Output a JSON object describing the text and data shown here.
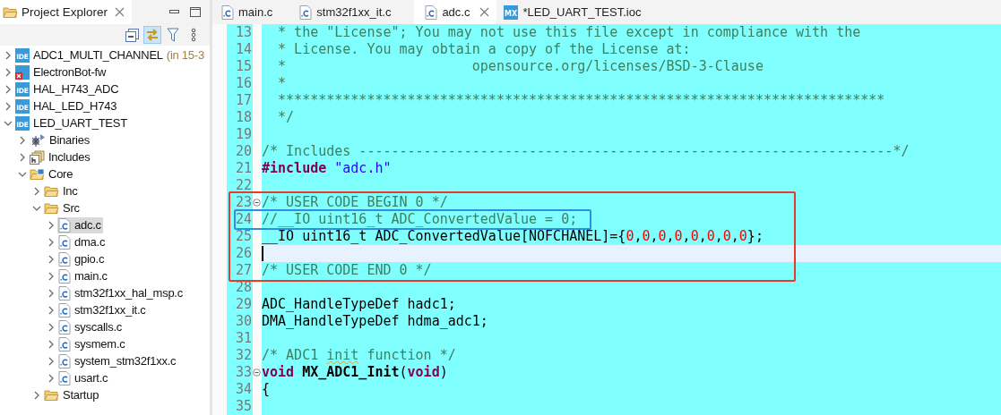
{
  "explorer": {
    "title": "Project Explorer",
    "toolbar": [
      {
        "kind": "collapse",
        "pressed": false
      },
      {
        "kind": "link",
        "pressed": true
      },
      {
        "kind": "filter",
        "pressed": false
      },
      {
        "kind": "more",
        "pressed": false
      }
    ],
    "tree": [
      {
        "kind": "project",
        "icon_label": "IDE",
        "label": "ADC1_MULTI_CHANNEL",
        "decoration": "(in 15-3",
        "error": false,
        "expanded": false,
        "selected": false
      },
      {
        "kind": "project",
        "label": "ElectronBot-fw",
        "error": true,
        "expanded": false,
        "selected": false
      },
      {
        "kind": "project",
        "icon_label": "IDE",
        "label": "HAL_H743_ADC",
        "error": false,
        "expanded": false,
        "selected": false
      },
      {
        "kind": "project",
        "icon_label": "IDE",
        "label": "HAL_LED_H743",
        "error": false,
        "expanded": false,
        "selected": false
      },
      {
        "kind": "project",
        "icon_label": "IDE",
        "label": "LED_UART_TEST",
        "error": false,
        "expanded": true,
        "selected": false,
        "children": [
          {
            "kind": "binaries",
            "label": "Binaries",
            "expanded": false,
            "selected": false
          },
          {
            "kind": "includes",
            "label": "Includes",
            "expanded": false,
            "selected": false
          },
          {
            "kind": "source_folder",
            "label": "Core",
            "expanded": true,
            "selected": false,
            "children": [
              {
                "kind": "folder",
                "label": "Inc",
                "expanded": false,
                "selected": false
              },
              {
                "kind": "folder",
                "label": "Src",
                "expanded": true,
                "selected": false,
                "children": [
                  {
                    "kind": "c_file",
                    "label": "adc.c",
                    "expanded": false,
                    "selected": true
                  },
                  {
                    "kind": "c_file",
                    "label": "dma.c",
                    "expanded": false,
                    "selected": false
                  },
                  {
                    "kind": "c_file",
                    "label": "gpio.c",
                    "expanded": false,
                    "selected": false
                  },
                  {
                    "kind": "c_file",
                    "label": "main.c",
                    "expanded": false,
                    "selected": false
                  },
                  {
                    "kind": "c_file",
                    "label": "stm32f1xx_hal_msp.c",
                    "expanded": false,
                    "selected": false
                  },
                  {
                    "kind": "c_file",
                    "label": "stm32f1xx_it.c",
                    "expanded": false,
                    "selected": false
                  },
                  {
                    "kind": "c_file",
                    "label": "syscalls.c",
                    "expanded": false,
                    "selected": false
                  },
                  {
                    "kind": "c_file",
                    "label": "sysmem.c",
                    "expanded": false,
                    "selected": false
                  },
                  {
                    "kind": "c_file",
                    "label": "system_stm32f1xx.c",
                    "expanded": false,
                    "selected": false
                  },
                  {
                    "kind": "c_file",
                    "label": "usart.c",
                    "expanded": false,
                    "selected": false
                  }
                ]
              },
              {
                "kind": "folder",
                "label": "Startup",
                "expanded": false,
                "selected": false
              }
            ]
          }
        ]
      }
    ]
  },
  "editor": {
    "tabs": [
      {
        "kind": "c_file",
        "label": "main.c",
        "selected": false
      },
      {
        "kind": "c_file",
        "label": "stm32f1xx_it.c",
        "selected": false
      },
      {
        "kind": "c_file",
        "label": "adc.c",
        "selected": true
      },
      {
        "kind": "mx",
        "icon_label": "MX",
        "label": "*LED_UART_TEST.ioc",
        "selected": false
      }
    ],
    "content": [
      {
        "kind": "line",
        "number": "13",
        "segments": [
          {
            "kind": "comment",
            "text": "  * the \"License\"; You may not use this file except in compliance with the"
          }
        ]
      },
      {
        "kind": "line",
        "number": "14",
        "segments": [
          {
            "kind": "comment",
            "text": "  * License. You may obtain a copy of the License at:"
          }
        ]
      },
      {
        "kind": "line",
        "number": "15",
        "segments": [
          {
            "kind": "comment",
            "text": "  *                       opensource.org/licenses/BSD-3-Clause"
          }
        ]
      },
      {
        "kind": "line",
        "number": "16",
        "segments": [
          {
            "kind": "comment",
            "text": "  *"
          }
        ]
      },
      {
        "kind": "line",
        "number": "17",
        "segments": [
          {
            "kind": "comment",
            "text": "  ***************************************************************************"
          }
        ]
      },
      {
        "kind": "line",
        "number": "18",
        "segments": [
          {
            "kind": "comment",
            "text": "  */"
          }
        ]
      },
      {
        "kind": "line",
        "number": "19"
      },
      {
        "kind": "line",
        "number": "20",
        "segments": [
          {
            "kind": "comment",
            "text": "/* Includes ------------------------------------------------------------------*/"
          }
        ]
      },
      {
        "kind": "line",
        "number": "21",
        "segments": [
          {
            "kind": "keyword",
            "text": "#include"
          },
          {
            "kind": "string",
            "text": " \"adc.h\""
          }
        ]
      },
      {
        "kind": "line",
        "number": "22"
      },
      {
        "kind": "box",
        "color": "#e53a2f",
        "items": [
          {
            "kind": "line",
            "number": "23",
            "foldable": true,
            "segments": [
              {
                "kind": "comment",
                "text": "/* USER CODE BEGIN 0 */"
              }
            ]
          },
          {
            "kind": "box",
            "color": "#2f8fdc",
            "items": [
              {
                "kind": "line",
                "number": "24",
                "segments": [
                  {
                    "kind": "comment",
                    "text": "//__IO uint16_t ADC_ConvertedValue = 0;"
                  }
                ]
              }
            ]
          },
          {
            "kind": "line",
            "number": "25",
            "segments": [
              {
                "kind": "plain",
                "text": "__IO uint16_t ADC_ConvertedValue[NOFCHANEL]={"
              },
              {
                "kind": "number",
                "text": "0"
              },
              {
                "kind": "plain",
                "text": ","
              },
              {
                "kind": "number",
                "text": "0"
              },
              {
                "kind": "plain",
                "text": ","
              },
              {
                "kind": "number",
                "text": "0"
              },
              {
                "kind": "plain",
                "text": ","
              },
              {
                "kind": "number",
                "text": "0"
              },
              {
                "kind": "plain",
                "text": ","
              },
              {
                "kind": "number",
                "text": "0"
              },
              {
                "kind": "plain",
                "text": ","
              },
              {
                "kind": "number",
                "text": "0"
              },
              {
                "kind": "plain",
                "text": ","
              },
              {
                "kind": "number",
                "text": "0"
              },
              {
                "kind": "plain",
                "text": ","
              },
              {
                "kind": "number",
                "text": "0"
              },
              {
                "kind": "plain",
                "text": "};"
              }
            ]
          },
          {
            "kind": "line",
            "number": "26",
            "current": true
          },
          {
            "kind": "line",
            "number": "27",
            "segments": [
              {
                "kind": "comment",
                "text": "/* USER CODE END 0 */"
              }
            ]
          }
        ]
      },
      {
        "kind": "line",
        "number": "28"
      },
      {
        "kind": "line",
        "number": "29",
        "segments": [
          {
            "kind": "plain",
            "text": "ADC_HandleTypeDef hadc1;"
          }
        ]
      },
      {
        "kind": "line",
        "number": "30",
        "segments": [
          {
            "kind": "plain",
            "text": "DMA_HandleTypeDef hdma_adc1;"
          }
        ]
      },
      {
        "kind": "line",
        "number": "31"
      },
      {
        "kind": "line",
        "number": "32",
        "segments": [
          {
            "kind": "comment",
            "text": "/* ADC1 "
          },
          {
            "kind": "misspelled_comment",
            "text": "init"
          },
          {
            "kind": "comment",
            "text": " function */"
          }
        ]
      },
      {
        "kind": "line",
        "number": "33",
        "foldable": true,
        "segments": [
          {
            "kind": "keyword",
            "text": "void"
          },
          {
            "kind": "function",
            "text": " MX_ADC1_Init"
          },
          {
            "kind": "plain",
            "text": "("
          },
          {
            "kind": "keyword",
            "text": "void"
          },
          {
            "kind": "plain",
            "text": ")"
          }
        ]
      },
      {
        "kind": "line",
        "number": "34",
        "segments": [
          {
            "kind": "plain",
            "text": "{"
          }
        ]
      },
      {
        "kind": "line",
        "number": "35"
      }
    ]
  }
}
